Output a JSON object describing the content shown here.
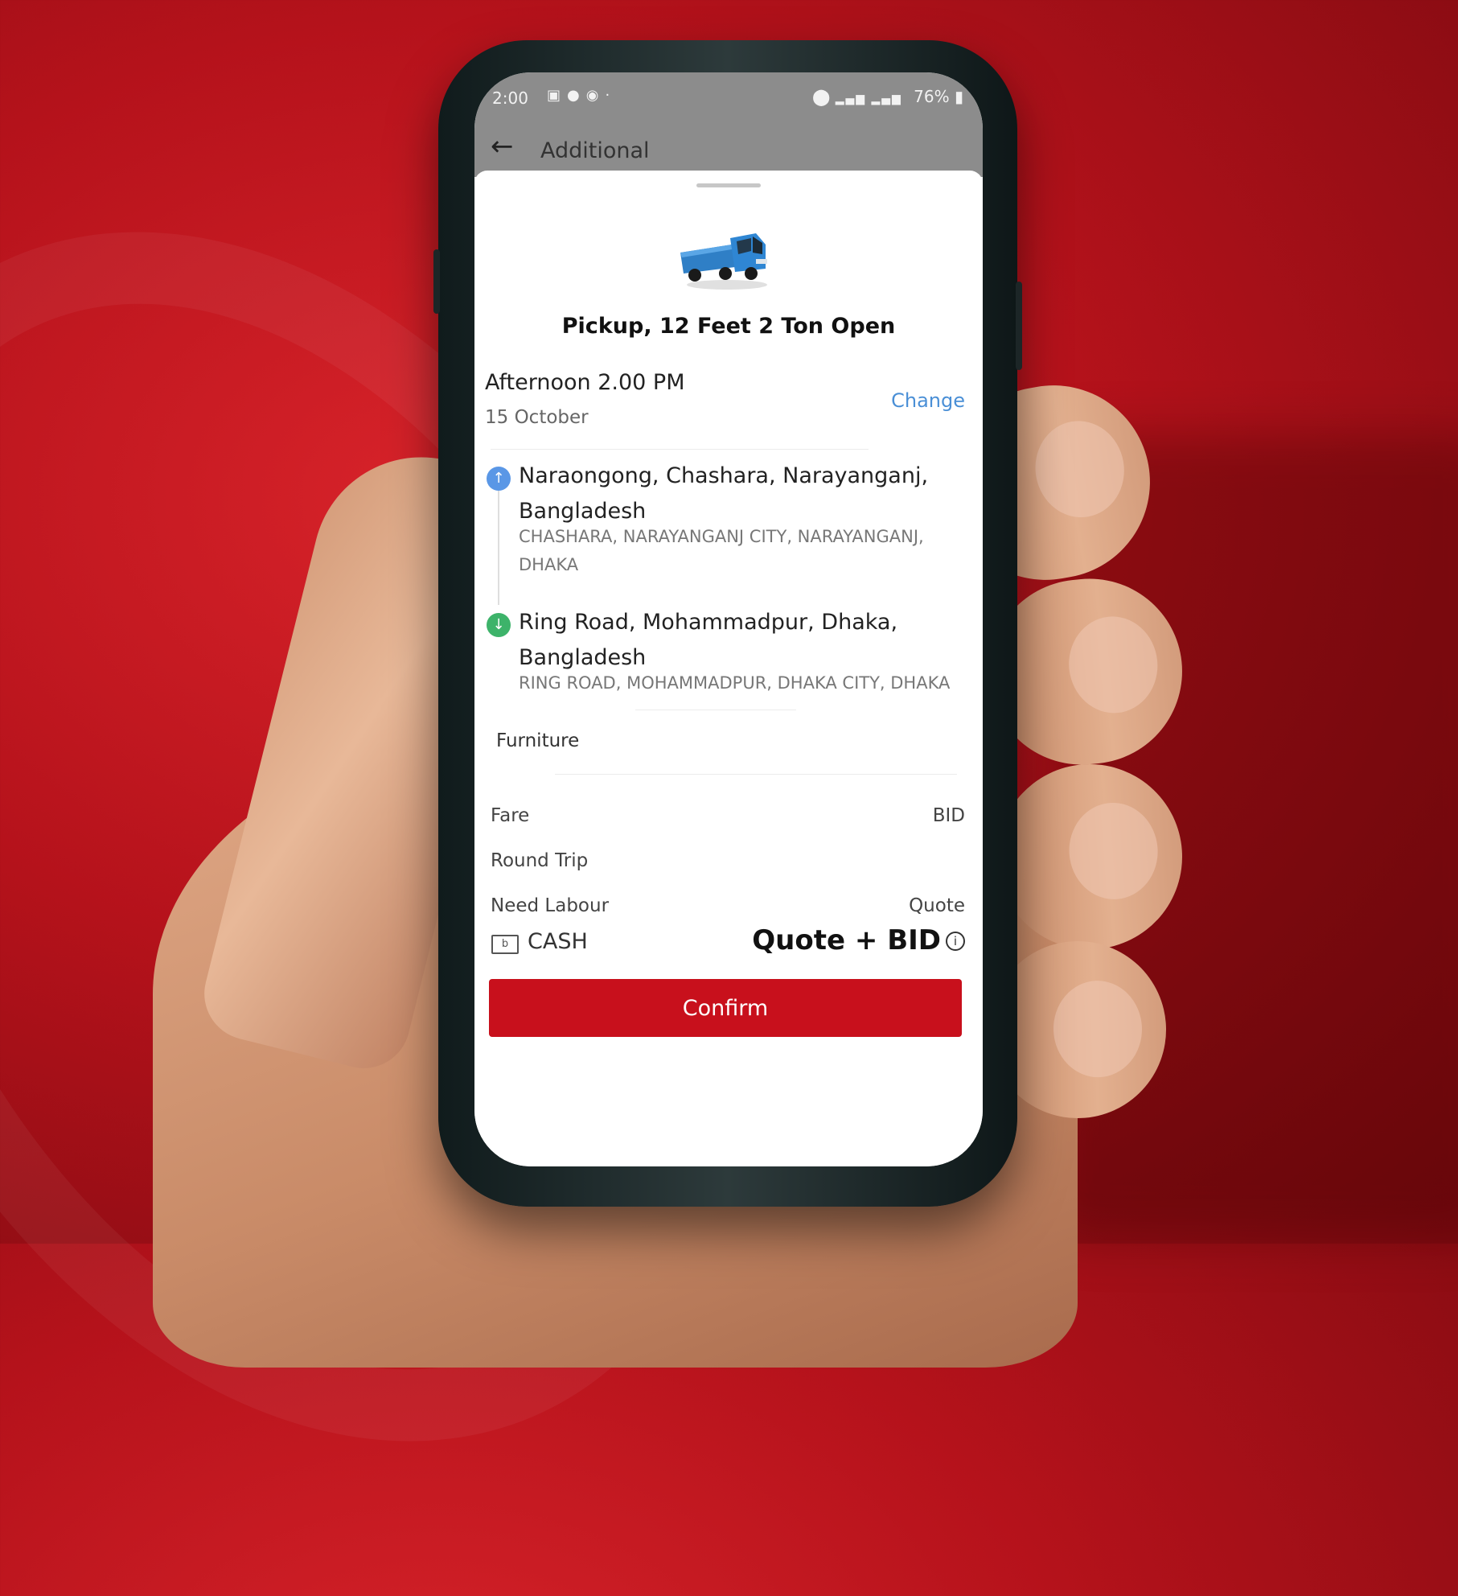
{
  "status_bar": {
    "time": "2:00",
    "battery": "76%",
    "notification_icons": [
      "gallery-icon",
      "messenger-icon",
      "chat-icon",
      "dot-icon"
    ],
    "right_icons": [
      "location-icon",
      "wifi-icon",
      "signal-icon",
      "battery-icon"
    ]
  },
  "app_bar": {
    "back_icon": "arrow-left-icon",
    "title": "Additional"
  },
  "vehicle": {
    "image": "blue-pickup-truck",
    "name": "Pickup, 12 Feet 2 Ton Open"
  },
  "schedule": {
    "time": "Afternoon 2.00 PM",
    "date": "15 October",
    "change_label": "Change"
  },
  "route": {
    "pickup": {
      "icon": "arrow-up-icon",
      "title": "Naraongong, Chashara, Narayanganj, Bangladesh",
      "detail": "CHASHARA, NARAYANGANJ CITY, NARAYANGANJ, DHAKA"
    },
    "dropoff": {
      "icon": "arrow-down-icon",
      "title": "Ring Road, Mohammadpur, Dhaka, Bangladesh",
      "detail": "RING ROAD, MOHAMMADPUR, DHAKA CITY, DHAKA"
    }
  },
  "goods_type": "Furniture",
  "summary": {
    "fare_label": "Fare",
    "fare_value": "BID",
    "round_trip_label": "Round Trip",
    "labour_label": "Need Labour",
    "labour_value": "Quote"
  },
  "payment": {
    "icon": "cash-icon",
    "method": "CASH",
    "total": "Quote + BID",
    "info_icon": "info-icon"
  },
  "confirm_label": "Confirm",
  "colors": {
    "accent_red": "#c8101c",
    "link_blue": "#4a8fd6",
    "pickup_pin": "#5a97e6",
    "dropoff_pin": "#3db36a"
  }
}
